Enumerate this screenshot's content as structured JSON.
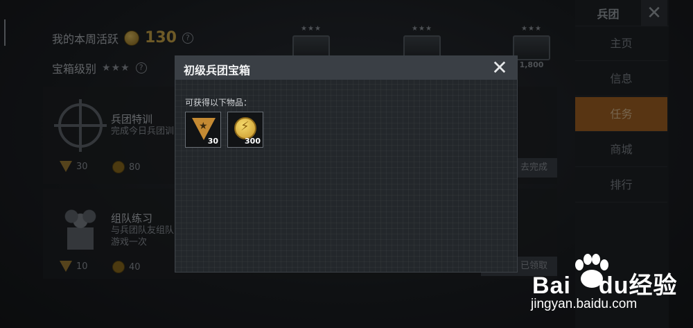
{
  "background": {
    "week_activity_label": "我的本周活跃",
    "week_activity_value": "130",
    "chest_level_label": "宝箱级别",
    "chest_level_stars": "★★★",
    "top_chests": [
      {
        "stars": "★★★",
        "value": ""
      },
      {
        "stars": "★★★",
        "value": ""
      },
      {
        "stars": "★★★",
        "value": "1,800"
      }
    ],
    "tasks": [
      {
        "title": "兵团特训",
        "desc": "完成今日兵团训",
        "reward_badge": "30",
        "reward_coin": "80",
        "button": "去完成"
      },
      {
        "title": "组队练习",
        "desc": "与兵团队友组队",
        "desc2": "游戏一次",
        "reward_badge": "10",
        "reward_coin": "40",
        "button": "已领取"
      }
    ]
  },
  "sidebar": {
    "title": "兵团",
    "close": "✕",
    "items": [
      {
        "label": "主页",
        "active": false
      },
      {
        "label": "信息",
        "active": false
      },
      {
        "label": "任务",
        "active": true
      },
      {
        "label": "商城",
        "active": false
      },
      {
        "label": "排行",
        "active": false
      }
    ]
  },
  "modal": {
    "title": "初级兵团宝箱",
    "close": "✕",
    "subtitle": "可获得以下物品：",
    "items": [
      {
        "icon": "legion-badge-icon",
        "qty": "30"
      },
      {
        "icon": "gold-coin-icon",
        "qty": "300"
      }
    ]
  },
  "watermark": {
    "logo_left": "Bai",
    "logo_mid": "du",
    "logo_right": "经验",
    "url": "jingyan.baidu.com"
  }
}
